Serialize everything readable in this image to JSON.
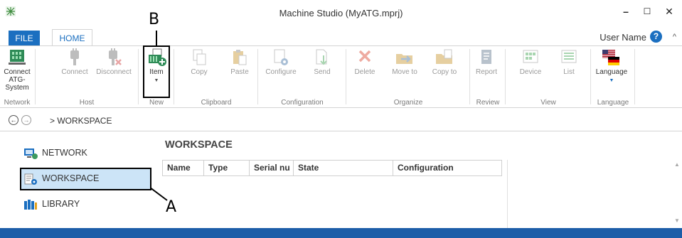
{
  "window": {
    "title": "Machine Studio (MyATG.mprj)",
    "minimize": "–",
    "maximize": "☐",
    "close": "✕"
  },
  "tabs": [
    {
      "label": "FILE"
    },
    {
      "label": "HOME"
    }
  ],
  "user": {
    "name": "User Name",
    "help": "?",
    "collapse": "^"
  },
  "ribbon": {
    "buttons": {
      "connect": "Connect ATG-System",
      "connect_host": "Connect",
      "disconnect": "Disconnect",
      "item": "Item",
      "copy": "Copy",
      "paste": "Paste",
      "configure": "Configure",
      "send": "Send",
      "delete": "Delete",
      "move_to": "Move to",
      "copy_to": "Copy to",
      "report": "Report",
      "device": "Device",
      "list": "List",
      "language": "Language"
    },
    "groups": {
      "network": "Network",
      "host": "Host",
      "new": "New",
      "clipboard": "Clipboard",
      "configuration": "Configuration",
      "organize": "Organize",
      "review": "Review",
      "view": "View",
      "language": "Language"
    },
    "dropdown_arrow": "▼"
  },
  "address": {
    "back": "←",
    "forward": "→",
    "path": "> WORKSPACE"
  },
  "sidebar": {
    "items": [
      {
        "label": "NETWORK"
      },
      {
        "label": "WORKSPACE"
      },
      {
        "label": "LIBRARY"
      }
    ]
  },
  "main": {
    "title": "WORKSPACE",
    "columns": [
      "Name",
      "Type",
      "Serial nu",
      "State",
      "Configuration"
    ]
  },
  "annotations": {
    "a": "A",
    "b": "B"
  },
  "colors": {
    "accent": "#1b6fc0",
    "statusbar": "#1d5da8",
    "selected": "#cce4f7"
  }
}
